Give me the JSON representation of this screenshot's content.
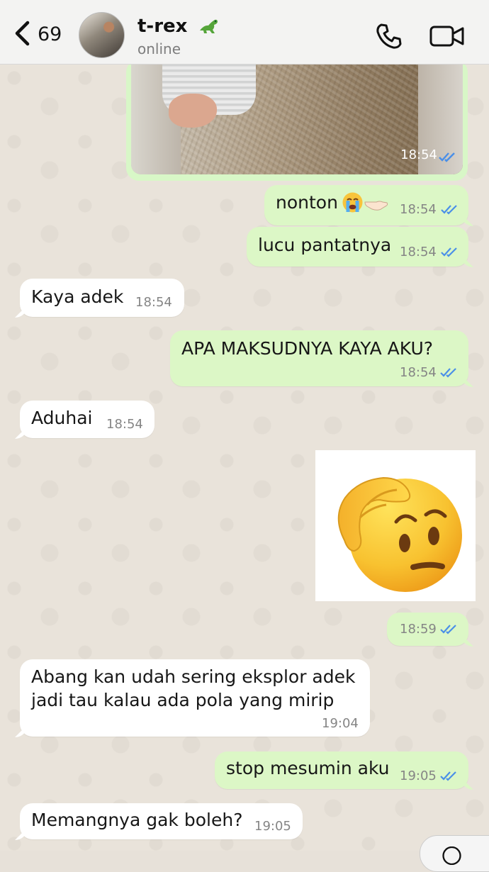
{
  "header": {
    "back_count": "69",
    "contact_name": "t-rex",
    "status": "online",
    "contact_emoji": "t-rex-dinosaur-emoji"
  },
  "messages": [
    {
      "type": "image",
      "direction": "out",
      "time": "18:54"
    },
    {
      "type": "text",
      "direction": "out",
      "text": "nonton",
      "emoji": "loudly-crying-face + pointing-hand",
      "time": "18:54"
    },
    {
      "type": "text",
      "direction": "out",
      "text": "lucu pantatnya",
      "time": "18:54"
    },
    {
      "type": "text",
      "direction": "in",
      "text": "Kaya adek",
      "time": "18:54"
    },
    {
      "type": "text",
      "direction": "out",
      "text": "APA MAKSUDNYA KAYA AKU?",
      "time": "18:54"
    },
    {
      "type": "text",
      "direction": "in",
      "text": "Aduhai",
      "time": "18:54"
    },
    {
      "type": "image",
      "direction": "out",
      "emoji": "face-with-hand-over-forehead",
      "time": "18:59"
    },
    {
      "type": "text",
      "direction": "in",
      "text_lines": [
        "Abang kan udah sering eksplor adek",
        "jadi tau kalau ada pola yang mirip"
      ],
      "time": "19:04"
    },
    {
      "type": "text",
      "direction": "out",
      "text": "stop mesumin aku",
      "time": "19:05"
    },
    {
      "type": "text",
      "direction": "in",
      "text": "Memangnya gak boleh?",
      "time": "19:05"
    }
  ],
  "colors": {
    "incoming_bubble": "#ffffff",
    "outgoing_bubble": "#dcf7c6",
    "read_tick": "#4a8fe8",
    "chat_background": "#e9e3da"
  }
}
